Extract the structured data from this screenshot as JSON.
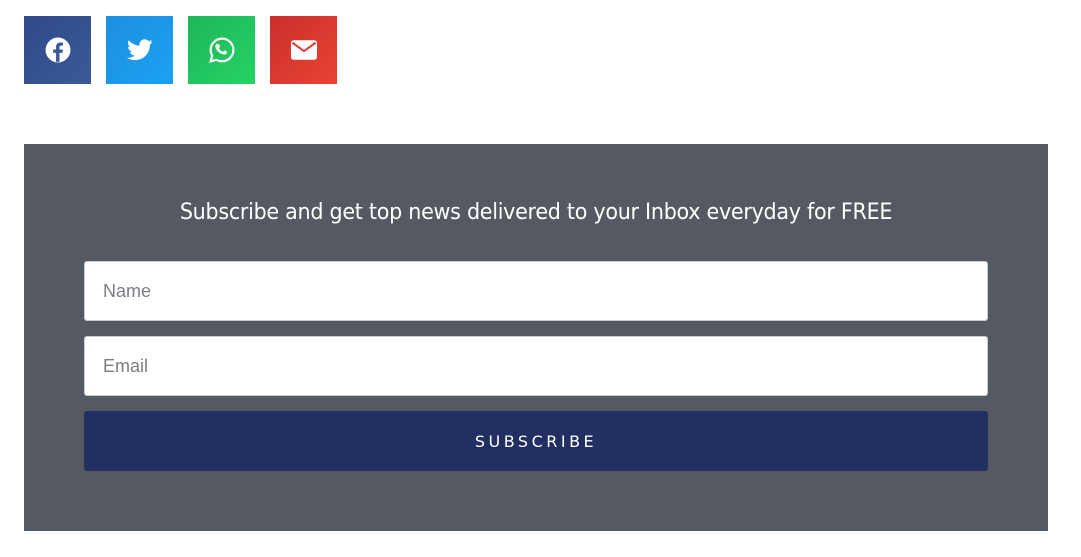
{
  "share": {
    "buttons": [
      {
        "name": "facebook",
        "icon": "facebook-icon",
        "color": "#3b5998"
      },
      {
        "name": "twitter",
        "icon": "twitter-icon",
        "color": "#1da1f2"
      },
      {
        "name": "whatsapp",
        "icon": "whatsapp-icon",
        "color": "#25d366"
      },
      {
        "name": "email",
        "icon": "envelope-icon",
        "color": "#ea4335"
      }
    ]
  },
  "subscribe": {
    "title": "Subscribe and get top news delivered to your Inbox everyday for FREE",
    "name_placeholder": "Name",
    "email_placeholder": "Email",
    "button_label": "SUBSCRIBE",
    "panel_color": "#555a62",
    "button_color": "#212f62"
  }
}
